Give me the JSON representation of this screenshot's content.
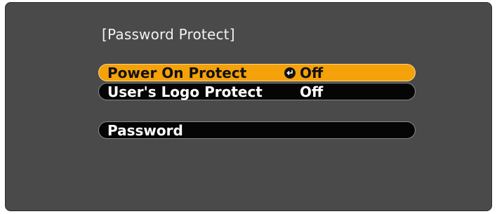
{
  "menu": {
    "title": "[Password Protect]",
    "items": [
      {
        "label": "Power On Protect",
        "value": "Off",
        "selected": true,
        "icon": "enter-icon"
      },
      {
        "label": "User's Logo Protect",
        "value": "Off",
        "selected": false
      },
      {
        "label": "Password",
        "value": "",
        "selected": false
      }
    ]
  },
  "colors": {
    "background": "#4a4a4a",
    "selected": "#f4a10a",
    "row": "#050505"
  }
}
